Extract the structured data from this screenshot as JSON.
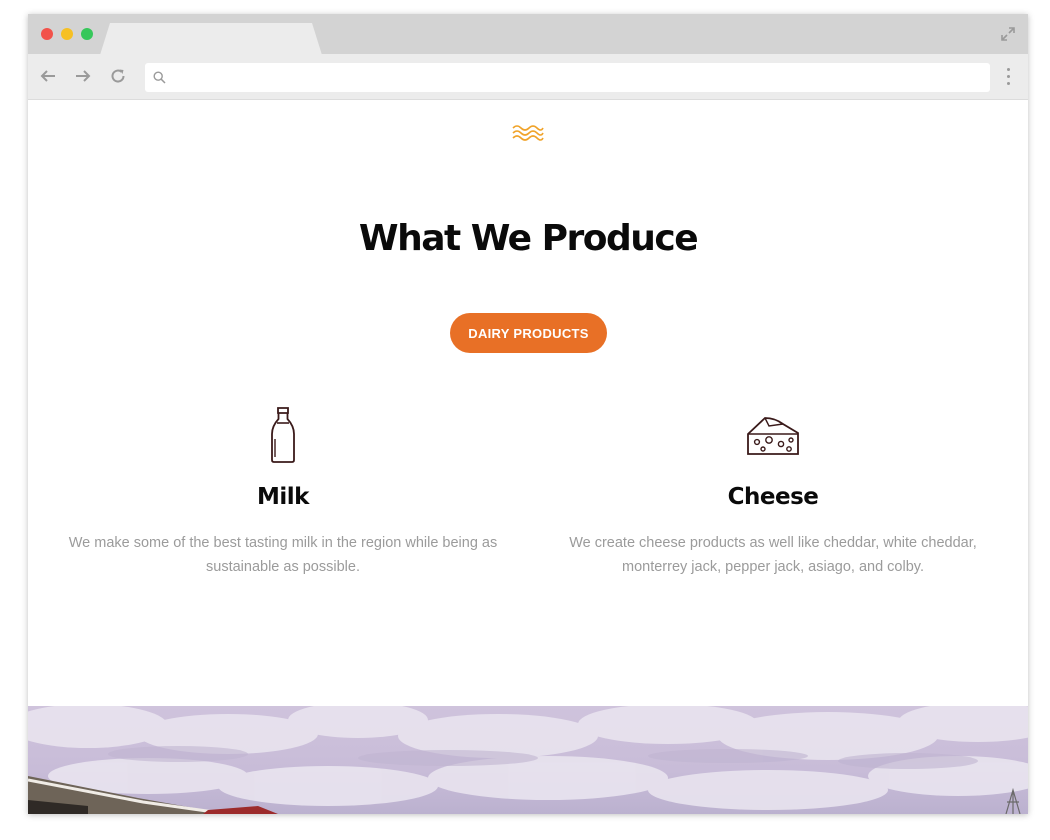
{
  "browser": {
    "url_value": "",
    "icons": {
      "close": "red-dot",
      "minimize": "yellow-dot",
      "maximize": "green-dot",
      "back": "arrow-left-icon",
      "forward": "arrow-right-icon",
      "reload": "reload-icon",
      "search": "search-icon",
      "menu": "kebab-icon",
      "expand": "expand-icon"
    }
  },
  "section": {
    "ornament": "waves-icon",
    "title": "What We Produce",
    "button_label": "DAIRY PRODUCTS",
    "accent_color": "#e87026",
    "items": [
      {
        "icon": "milk-bottle-icon",
        "title": "Milk",
        "description": "We make some of the best tasting milk in the region while being as sustainable as possible."
      },
      {
        "icon": "cheese-icon",
        "title": "Cheese",
        "description": "We create cheese products as well like cheddar, white cheddar, monterrey jack, pepper jack, asiago, and colby."
      }
    ]
  },
  "hero_image": "farm-sky-photo"
}
